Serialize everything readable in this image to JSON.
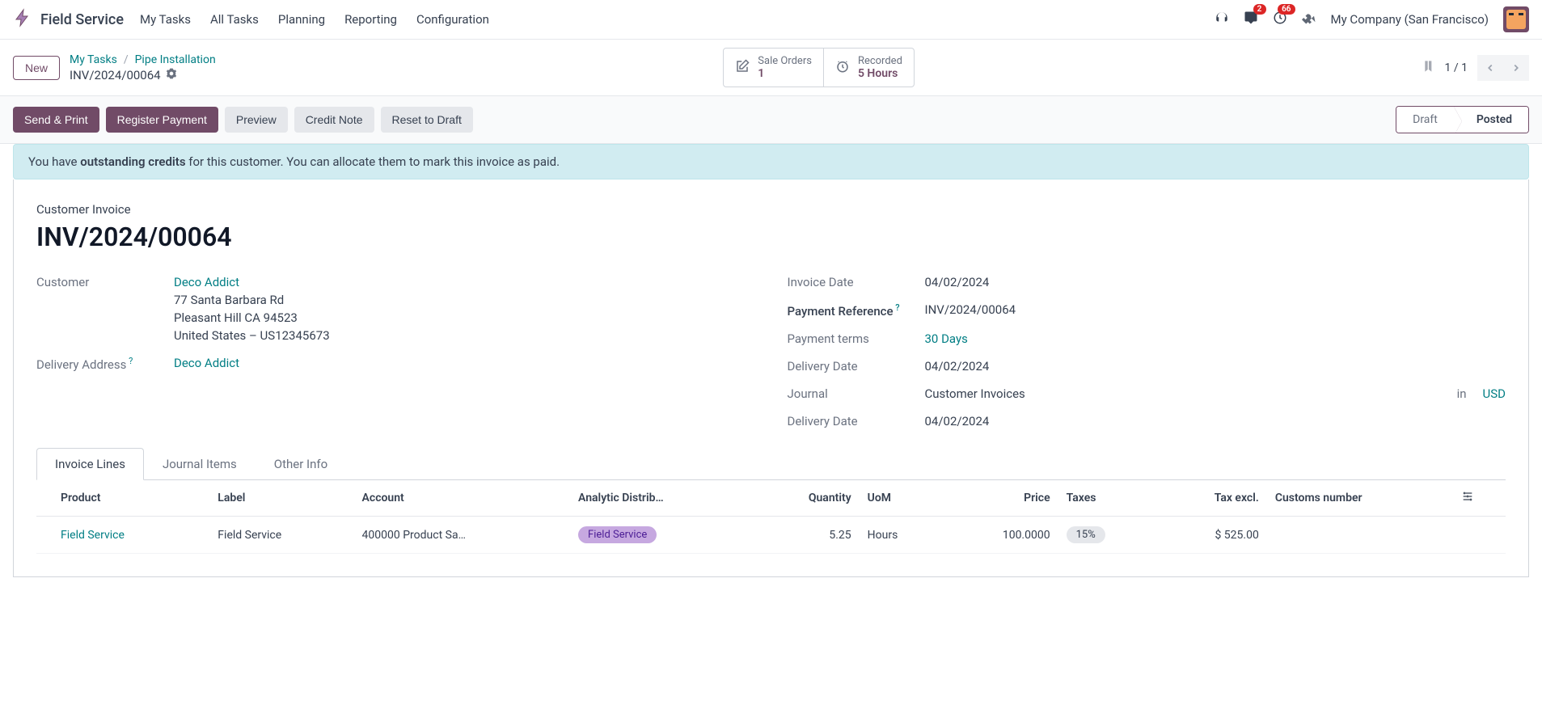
{
  "navbar": {
    "app_name": "Field Service",
    "links": [
      "My Tasks",
      "All Tasks",
      "Planning",
      "Reporting",
      "Configuration"
    ],
    "badges": {
      "chat": "2",
      "clock": "66"
    },
    "company": "My Company (San Francisco)"
  },
  "breadcrumb": {
    "new_btn": "New",
    "path1": "My Tasks",
    "path2": "Pipe Installation",
    "current": "INV/2024/00064",
    "stat1_label": "Sale Orders",
    "stat1_value": "1",
    "stat2_label": "Recorded",
    "stat2_value": "5 Hours",
    "pager": "1 / 1"
  },
  "actions": {
    "send_print": "Send & Print",
    "register_payment": "Register Payment",
    "preview": "Preview",
    "credit_note": "Credit Note",
    "reset_draft": "Reset to Draft",
    "status_draft": "Draft",
    "status_posted": "Posted"
  },
  "alert": {
    "prefix": "You have ",
    "bold": "outstanding credits",
    "suffix": " for this customer. You can allocate them to mark this invoice as paid."
  },
  "sheet": {
    "doc_type": "Customer Invoice",
    "doc_number": "INV/2024/00064",
    "customer_label": "Customer",
    "customer_name": "Deco Addict",
    "address_street": "77 Santa Barbara Rd",
    "address_city": "Pleasant Hill CA 94523",
    "address_country": "United States – US12345673",
    "delivery_addr_label": "Delivery Address",
    "delivery_addr_value": "Deco Addict",
    "invoice_date_label": "Invoice Date",
    "invoice_date_value": "04/02/2024",
    "payment_ref_label": "Payment Reference",
    "payment_ref_value": "INV/2024/00064",
    "payment_terms_label": "Payment terms",
    "payment_terms_value": "30 Days",
    "delivery_date_label": "Delivery Date",
    "delivery_date_value": "04/02/2024",
    "journal_label": "Journal",
    "journal_value": "Customer Invoices",
    "journal_in": "in",
    "journal_currency": "USD",
    "delivery_date2_label": "Delivery Date",
    "delivery_date2_value": "04/02/2024"
  },
  "tabs": {
    "invoice_lines": "Invoice Lines",
    "journal_items": "Journal Items",
    "other_info": "Other Info"
  },
  "table": {
    "headers": {
      "product": "Product",
      "label": "Label",
      "account": "Account",
      "analytic": "Analytic Distrib…",
      "quantity": "Quantity",
      "uom": "UoM",
      "price": "Price",
      "taxes": "Taxes",
      "tax_excl": "Tax excl.",
      "customs": "Customs number"
    },
    "row1": {
      "product": "Field Service",
      "label": "Field Service",
      "account": "400000 Product Sa…",
      "analytic": "Field Service",
      "quantity": "5.25",
      "uom": "Hours",
      "price": "100.0000",
      "taxes": "15%",
      "tax_excl": "$ 525.00",
      "customs": ""
    }
  }
}
